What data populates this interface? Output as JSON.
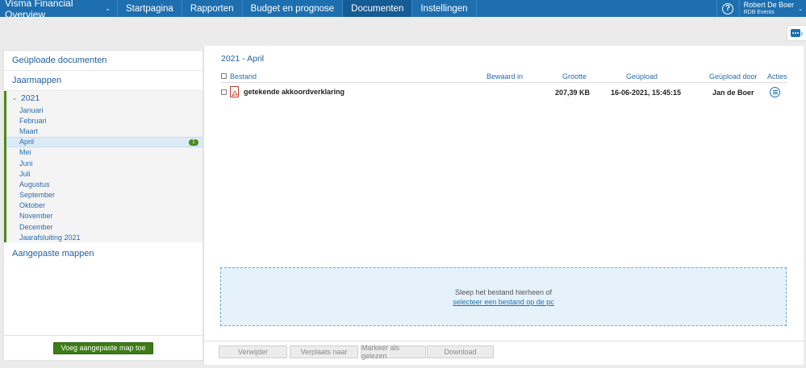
{
  "nav": {
    "brand": "Visma Financial Overview",
    "items": [
      {
        "label": "Startpagina",
        "active": false
      },
      {
        "label": "Rapporten",
        "active": false
      },
      {
        "label": "Budget en prognose",
        "active": false
      },
      {
        "label": "Documenten",
        "active": true
      },
      {
        "label": "Instellingen",
        "active": false
      }
    ],
    "help_symbol": "?",
    "user_name": "Robert De Boer",
    "user_org": "RDB Events",
    "chevron": "⌄"
  },
  "sidebar": {
    "uploaded": "Geüploade documenten",
    "yearfolders": "Jaarmappen",
    "year": "2021",
    "months": [
      "Januari",
      "Februari",
      "Maart",
      "April",
      "Mei",
      "Juni",
      "Juli",
      "Augustus",
      "September",
      "Oktober",
      "November",
      "December",
      "Jaarafsluiting 2021"
    ],
    "selected_month": "April",
    "selected_badge": "1",
    "custom_folders": "Aangepaste mappen",
    "add_button": "Voeg aangepaste map toe"
  },
  "main": {
    "title": "2021 - April",
    "columns": {
      "file": "Bestand",
      "stored_in": "Bewaard in",
      "size": "Grootte",
      "uploaded": "Geüpload",
      "uploaded_by": "Geüpload door",
      "actions": "Acties"
    },
    "rows": [
      {
        "name": "getekende akkoordverklaring",
        "stored_in": "",
        "size": "207,39 KB",
        "uploaded": "16-06-2021, 15:45:15",
        "uploaded_by": "Jan de Boer"
      }
    ],
    "dropzone_text": "Sleep het bestand hierheen of",
    "dropzone_link": "selecteer een bestand op de pc",
    "buttons": {
      "delete": "Verwijder",
      "move": "Verplaats naar",
      "mark_read": "Markeer als gelezen",
      "download": "Download"
    }
  },
  "colors": {
    "nav_bg": "#1d6fb0",
    "nav_active": "#155b94",
    "accent_green": "#3d7c16",
    "link_blue": "#1d5e9f",
    "dropzone_bg": "#e6f2fa"
  }
}
